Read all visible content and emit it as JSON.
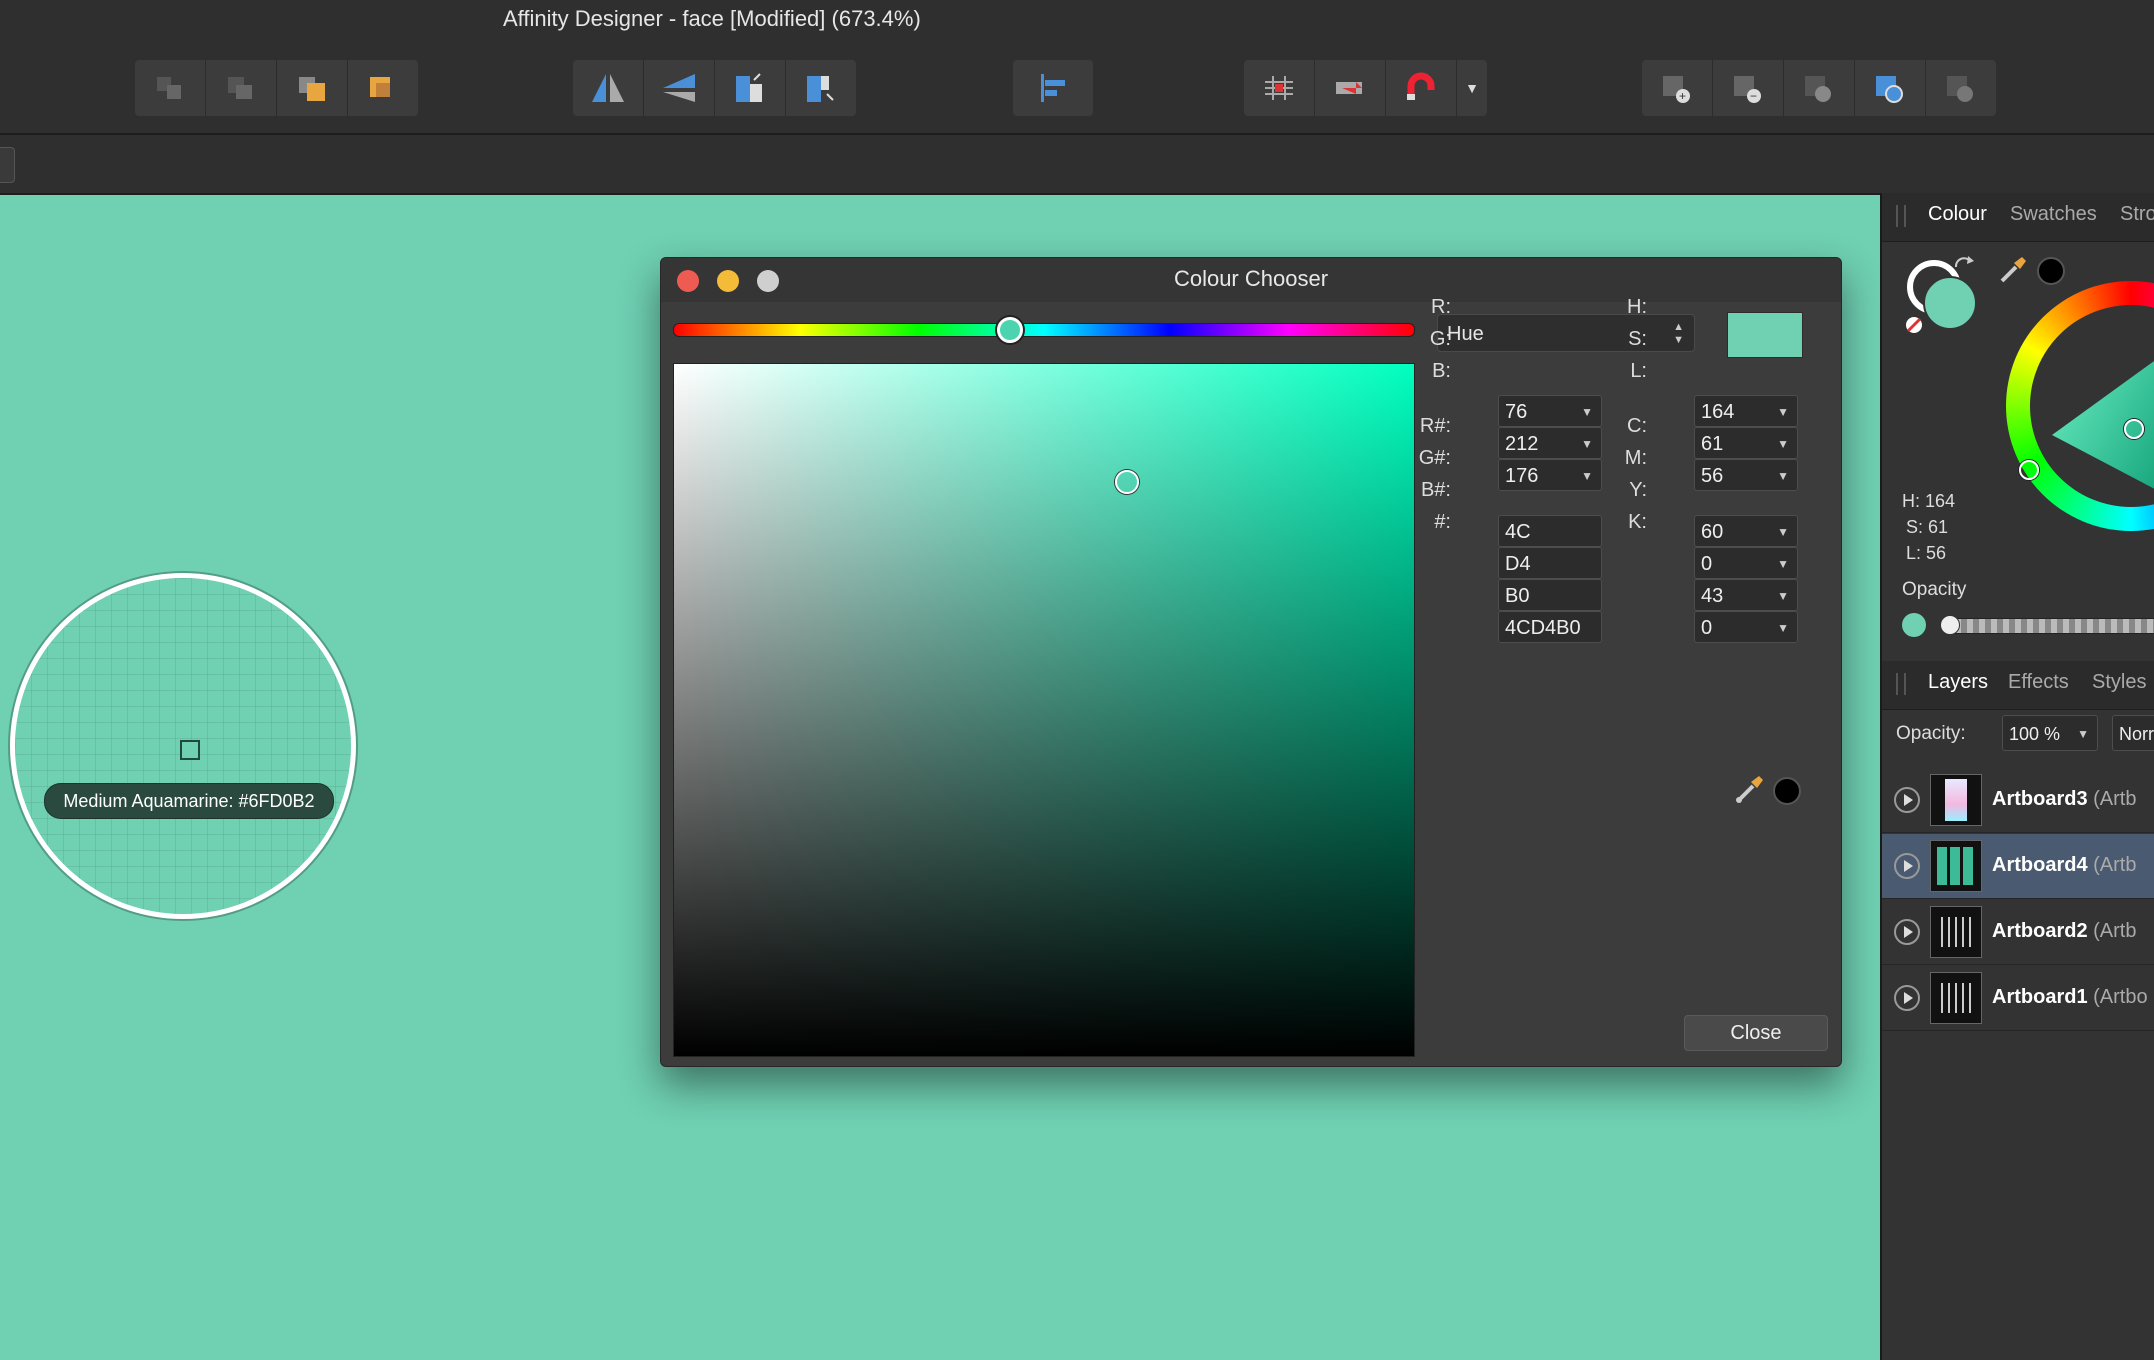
{
  "app": {
    "title": "Affinity Designer - face [Modified] (673.4%)"
  },
  "toolbar": {
    "arrange_icons": [
      "move-to-back-icon",
      "move-back-one-icon",
      "move-forward-one-icon",
      "move-to-front-icon"
    ],
    "transform_icons": [
      "flip-horizontal-icon",
      "flip-vertical-icon",
      "rotate-left-icon",
      "rotate-right-icon"
    ],
    "align_icon": "align-left-icon",
    "snapping_icons": [
      "pixel-grid-icon",
      "snap-to-pixel-icon",
      "snapping-magnet-icon"
    ],
    "boolean_icons": [
      "add-icon",
      "subtract-icon",
      "intersect-icon",
      "divide-icon",
      "combine-icon"
    ]
  },
  "loupe": {
    "label": "Medium Aquamarine: #6FD0B2"
  },
  "colour_chooser": {
    "title": "Colour Chooser",
    "model": "Hue",
    "hue_position": 0.455,
    "saturation": 0.61,
    "brightness": 0.83,
    "rgb": {
      "r_label": "R:",
      "r": "76",
      "g_label": "G:",
      "g": "212",
      "b_label": "B:",
      "b": "176"
    },
    "hsl": {
      "h_label": "H:",
      "h": "164",
      "s_label": "S:",
      "s": "61",
      "l_label": "L:",
      "l": "56"
    },
    "hex": {
      "r_label": "R#:",
      "r": "4C",
      "g_label": "G#:",
      "g": "D4",
      "b_label": "B#:",
      "b": "B0",
      "all_label": "#:",
      "all": "4CD4B0"
    },
    "cmyk": {
      "c_label": "C:",
      "c": "60",
      "m_label": "M:",
      "m": "0",
      "y_label": "Y:",
      "y": "43",
      "k_label": "K:",
      "k": "0"
    },
    "close_label": "Close",
    "colors": {
      "current": "#4CD4B0",
      "preview": "#6FD0B2"
    }
  },
  "colour_panel": {
    "tabs": [
      "Colour",
      "Swatches",
      "Stro"
    ],
    "hsl_readout": {
      "h": "H: 164",
      "s": "S: 61",
      "l": "L: 56"
    },
    "opacity_label": "Opacity"
  },
  "layers_panel": {
    "tabs": [
      "Layers",
      "Effects",
      "Styles"
    ],
    "opacity_label": "Opacity:",
    "opacity_value": "100 %",
    "blend_mode": "Norr",
    "layers": [
      {
        "name": "Artboard3",
        "type": "(Artb",
        "selected": false
      },
      {
        "name": "Artboard4",
        "type": "(Artb",
        "selected": true
      },
      {
        "name": "Artboard2",
        "type": "(Artb",
        "selected": false
      },
      {
        "name": "Artboard1",
        "type": "(Artbo",
        "selected": false
      }
    ]
  }
}
